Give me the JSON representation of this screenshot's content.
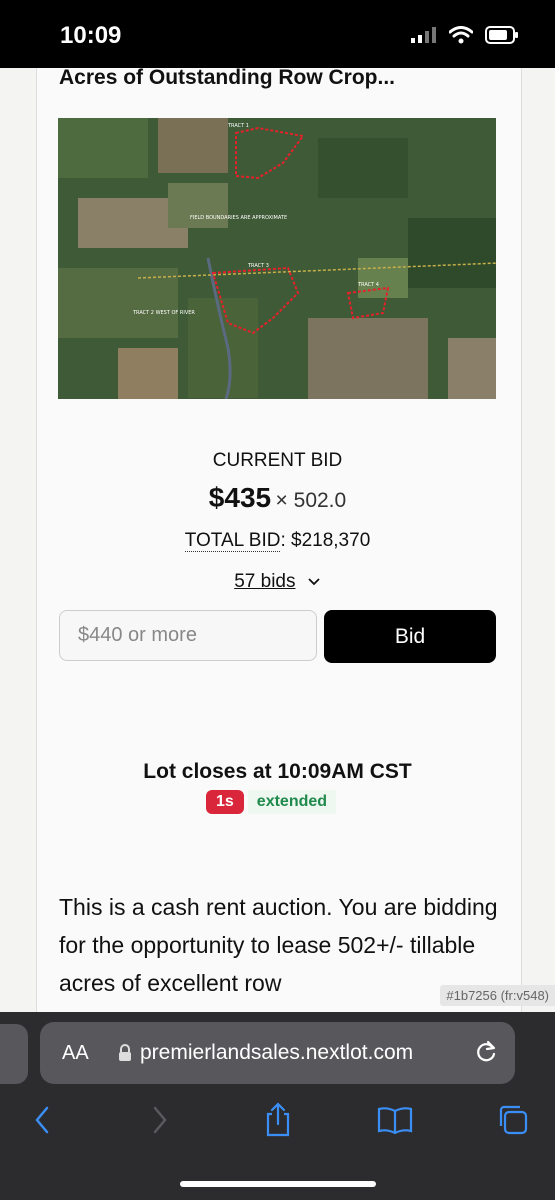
{
  "status_bar": {
    "time": "10:09"
  },
  "lot": {
    "title": "Acres of Outstanding Row Crop...",
    "map_labels": {
      "tract1": "TRACT 1",
      "field_note": "FIELD BOUNDARIES ARE APPROXIMATE",
      "tract3": "TRACT 3",
      "tract4": "TRACT 4",
      "tract2": "TRACT 2 WEST OF RIVER"
    }
  },
  "bidding": {
    "current_bid_label": "CURRENT BID",
    "amount": "$435",
    "multiplier": "× 502.0",
    "total_label": "TOTAL BID",
    "total_colon": ":",
    "total_value": "$218,370",
    "bids_count": "57 bids",
    "input_placeholder": "$440 or more",
    "bid_button": "Bid"
  },
  "closing": {
    "text": "Lot closes at 10:09AM CST",
    "countdown": "1s",
    "status": "extended"
  },
  "description": "This is a cash rent auction. You are bidding for the opportunity to lease 502+/- tillable acres of excellent row",
  "version_tag": "#1b7256 (fr:v548)",
  "browser": {
    "aa_label": "AA",
    "url": "premierlandsales.nextlot.com"
  },
  "colors": {
    "badge_red": "#d9263a",
    "extended_green": "#1f8a4c",
    "button_black": "#000000"
  }
}
